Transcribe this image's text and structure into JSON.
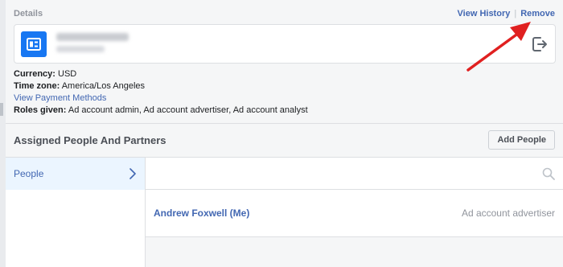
{
  "details": {
    "title": "Details",
    "view_history_label": "View History",
    "separator": "|",
    "remove_label": "Remove"
  },
  "account": {
    "icon": "ad-account-icon",
    "exit_icon": "exit-icon"
  },
  "info": {
    "currency_label": "Currency:",
    "currency_value": "USD",
    "timezone_label": "Time zone:",
    "timezone_value": "America/Los Angeles",
    "payment_link": "View Payment Methods",
    "roles_label": "Roles given:",
    "roles_value": "Ad account admin, Ad account advertiser, Ad account analyst"
  },
  "assigned": {
    "title": "Assigned People And Partners",
    "add_people_label": "Add People"
  },
  "sidebar": {
    "people_label": "People"
  },
  "people": {
    "search_placeholder": "",
    "rows": [
      {
        "name": "Andrew Foxwell (Me)",
        "role": "Ad account advertiser"
      }
    ]
  },
  "colors": {
    "link": "#4267b2",
    "accent": "#1877f2",
    "annotation": "#e02020"
  }
}
